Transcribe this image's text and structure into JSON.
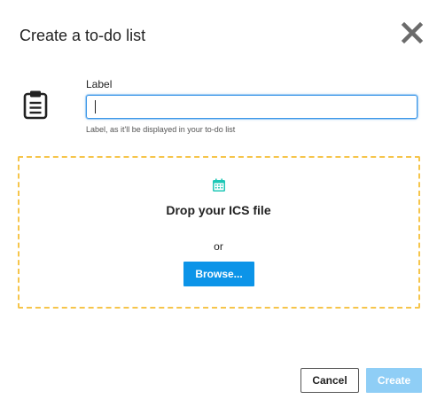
{
  "dialog": {
    "title": "Create a to-do list",
    "close_icon": "close-icon"
  },
  "form": {
    "label_icon": "clipboard-icon",
    "label": "Label",
    "input_value": "",
    "helper": "Label, as it'll be displayed in your to-do list"
  },
  "dropzone": {
    "icon": "calendar-icon",
    "heading": "Drop your ICS file",
    "or": "or",
    "browse_label": "Browse...",
    "border_color": "#f6c54b"
  },
  "footer": {
    "cancel_label": "Cancel",
    "create_label": "Create",
    "create_disabled": true
  },
  "colors": {
    "accent": "#0c94e8",
    "accent_disabled": "#8fcef6",
    "icon_teal": "#1fc7b6"
  }
}
